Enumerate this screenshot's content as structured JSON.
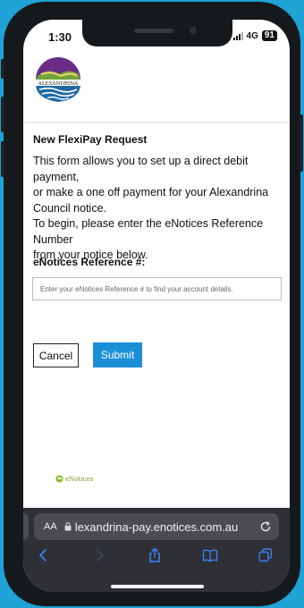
{
  "status_bar": {
    "time": "1:30",
    "network": "4G",
    "battery": "91"
  },
  "header": {
    "logo_icon": "alexandrina-council-logo",
    "logo_text": "ALEXANDRINA"
  },
  "form": {
    "title": "New FlexiPay Request",
    "description_lines": [
      "This form allows you to set up a direct debit payment,",
      "or make a one off payment for your Alexandrina",
      "Council notice.",
      "To begin, please enter the eNotices Reference Number",
      "from your notice below."
    ],
    "reference_label": "eNotices Reference #:",
    "reference_placeholder": "Enter your eNotices Reference # to find your account details.",
    "reference_value": "",
    "cancel_label": "Cancel",
    "submit_label": "Submit"
  },
  "footer": {
    "brand": "eNotices"
  },
  "browser": {
    "text_size_label": "AA",
    "url": "lexandrina-pay.enotices.com.au",
    "icons": [
      "back-icon",
      "forward-icon",
      "share-icon",
      "bookmarks-icon",
      "tabs-icon",
      "reload-icon",
      "lock-icon"
    ]
  },
  "colors": {
    "background": "#1fa2d4",
    "submit": "#1a8fd8",
    "safari_bar": "#2e3035",
    "accent_blue": "#3b82f6"
  }
}
